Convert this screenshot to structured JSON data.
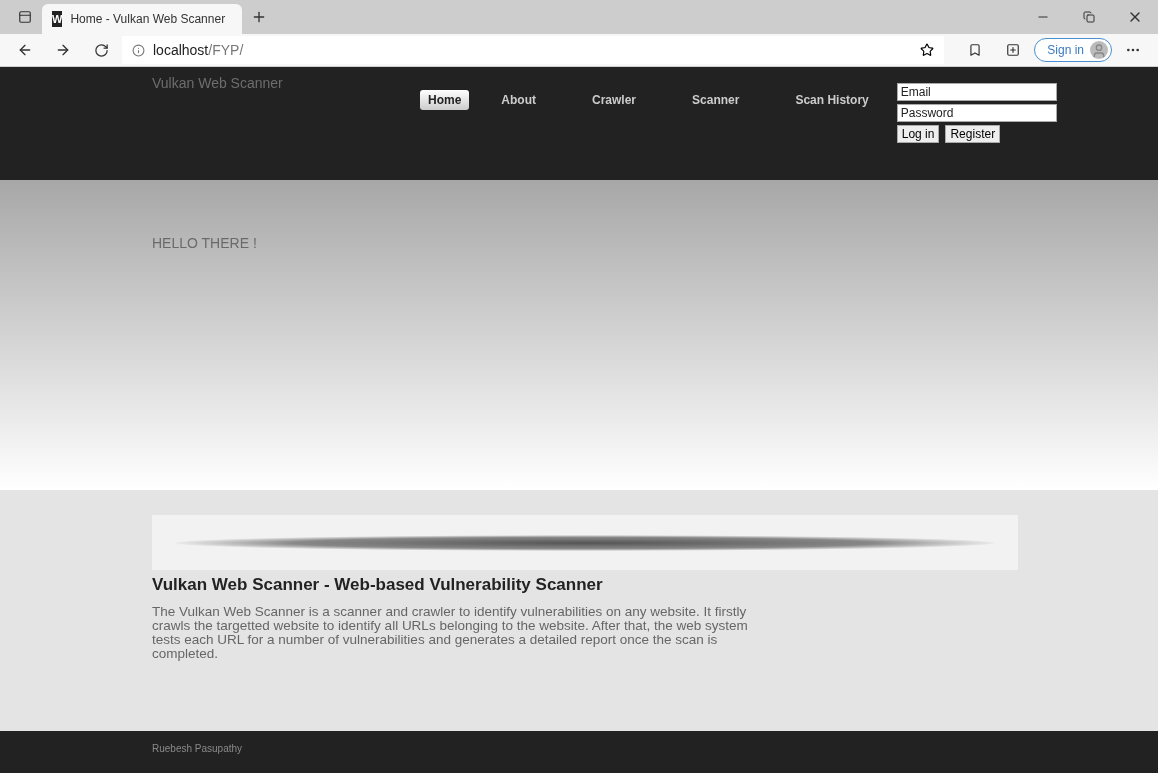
{
  "browser": {
    "tab_title": "Home - Vulkan Web Scanner",
    "favicon": "W",
    "url_host": "localhost",
    "url_path": "/FYP/",
    "sign_in": "Sign in"
  },
  "header": {
    "site_title": "Vulkan Web Scanner",
    "nav": [
      {
        "label": "Home",
        "selected": true
      },
      {
        "label": "About",
        "selected": false
      },
      {
        "label": "Crawler",
        "selected": false
      },
      {
        "label": "Scanner",
        "selected": false
      },
      {
        "label": "Scan History",
        "selected": false
      }
    ],
    "login": {
      "email_placeholder": "Email",
      "password_placeholder": "Password",
      "buttons": [
        "Log in",
        "Register"
      ]
    }
  },
  "hero": {
    "greeting": "HELLO THERE !"
  },
  "content": {
    "heading": "Vulkan Web Scanner - Web-based Vulnerability Scanner",
    "paragraph": "The Vulkan Web Scanner is a scanner and crawler to identify vulnerabilities on any website. It firstly crawls the targetted website to identify all URLs belonging to the website. After that, the web system tests each URL for a number of vulnerabilities and generates a detailed report once the scan is completed."
  },
  "footer": {
    "author": "Ruebesh Pasupathy"
  }
}
